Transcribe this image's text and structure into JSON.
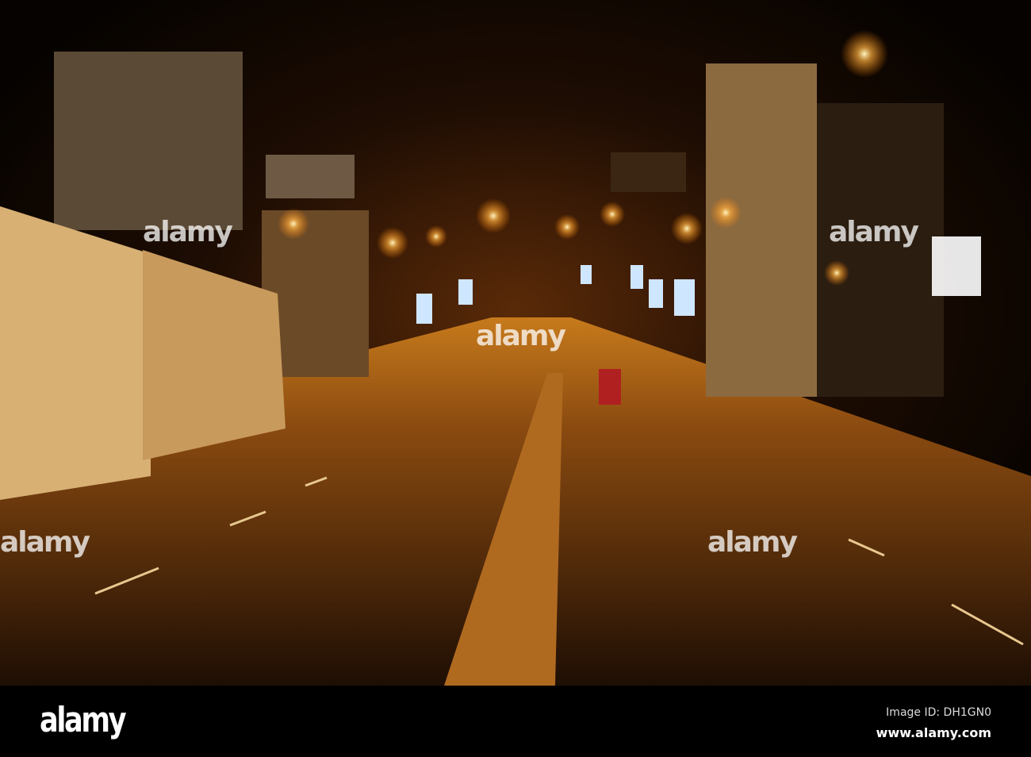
{
  "photo": {
    "subject": "night-city-road"
  },
  "watermark": {
    "text": "alamy"
  },
  "footer": {
    "logo": "alamy",
    "image_id": "Image ID: DH1GN0",
    "url": "www.alamy.com"
  }
}
